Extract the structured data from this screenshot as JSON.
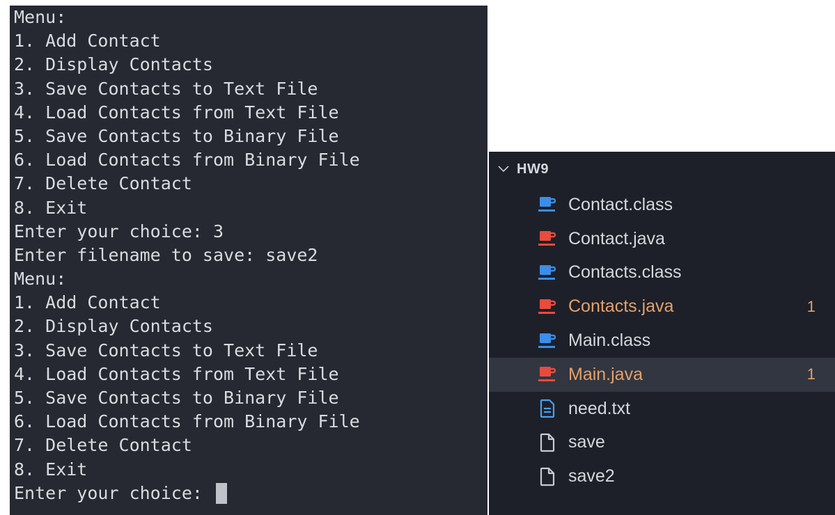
{
  "terminal": {
    "lines": [
      "Menu:",
      "1. Add Contact",
      "2. Display Contacts",
      "3. Save Contacts to Text File",
      "4. Load Contacts from Text File",
      "5. Save Contacts to Binary File",
      "6. Load Contacts from Binary File",
      "7. Delete Contact",
      "8. Exit",
      "Enter your choice: 3",
      "Enter filename to save: save2",
      "Menu:",
      "1. Add Contact",
      "2. Display Contacts",
      "3. Save Contacts to Text File",
      "4. Load Contacts from Text File",
      "5. Save Contacts to Binary File",
      "6. Load Contacts from Binary File",
      "7. Delete Contact",
      "8. Exit"
    ],
    "prompt": "Enter your choice: "
  },
  "explorer": {
    "folder": "HW9",
    "files": [
      {
        "name": "Contact.class",
        "icon": "java-class-icon",
        "icon_color": "#3b8eea",
        "badge": ""
      },
      {
        "name": "Contact.java",
        "icon": "java-source-icon",
        "icon_color": "#e94b3c",
        "badge": ""
      },
      {
        "name": "Contacts.class",
        "icon": "java-class-icon",
        "icon_color": "#3b8eea",
        "badge": ""
      },
      {
        "name": "Contacts.java",
        "icon": "java-source-icon",
        "icon_color": "#e94b3c",
        "badge": "1"
      },
      {
        "name": "Main.class",
        "icon": "java-class-icon",
        "icon_color": "#3b8eea",
        "badge": ""
      },
      {
        "name": "Main.java",
        "icon": "java-source-icon",
        "icon_color": "#e94b3c",
        "badge": "1",
        "selected": true
      },
      {
        "name": "need.txt",
        "icon": "text-file-icon",
        "icon_color": "#4aa0f0",
        "badge": ""
      },
      {
        "name": "save",
        "icon": "file-icon",
        "icon_color": "#c8cad0",
        "badge": ""
      },
      {
        "name": "save2",
        "icon": "file-icon",
        "icon_color": "#c8cad0",
        "badge": ""
      }
    ]
  },
  "colors": {
    "terminal_bg": "#262932",
    "explorer_bg": "#1d2029",
    "selected_row": "#323641",
    "modified_text": "#e4a06a"
  }
}
